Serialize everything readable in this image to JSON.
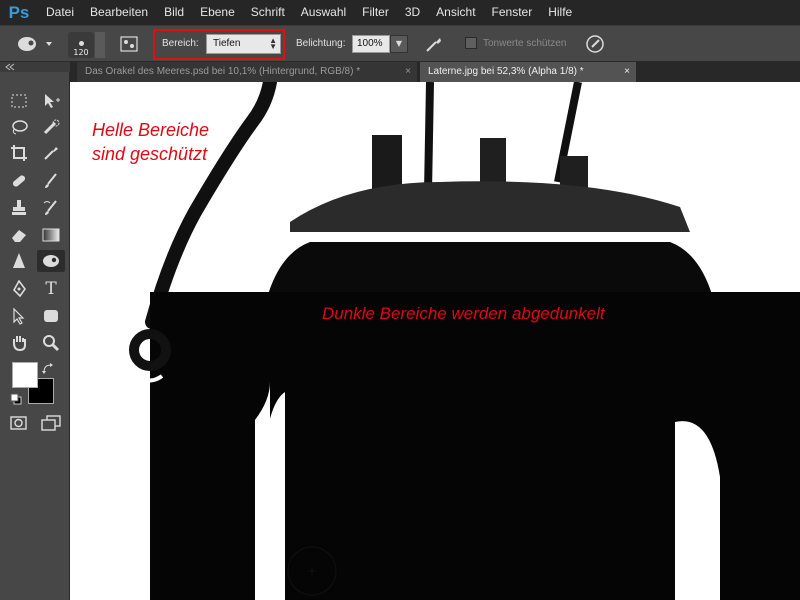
{
  "app": {
    "logo": "Ps"
  },
  "menu": [
    "Datei",
    "Bearbeiten",
    "Bild",
    "Ebene",
    "Schrift",
    "Auswahl",
    "Filter",
    "3D",
    "Ansicht",
    "Fenster",
    "Hilfe"
  ],
  "options": {
    "brush_size": "120",
    "range_label": "Bereich:",
    "range_value": "Tiefen",
    "exposure_label": "Belichtung:",
    "exposure_value": "100%",
    "protect_tones_label": "Tonwerte schützen"
  },
  "tabs": [
    {
      "label": "Das Orakel des Meeres.psd bei 10,1% (Hintergrund, RGB/8) *",
      "close": "×"
    },
    {
      "label": "Laterne.jpg bei 52,3% (Alpha 1/8) *",
      "close": "×"
    }
  ],
  "captions": {
    "bright_line1": "Helle Bereiche",
    "bright_line2": "sind geschützt",
    "dark": "Dunkle Bereiche werden abgedunkelt"
  },
  "colors": {
    "accent_red": "#e30613",
    "foreground": "#ffffff",
    "background": "#000000"
  },
  "toolbar_icons": [
    "marquee-icon",
    "move-icon",
    "lasso-icon",
    "quick-selection-icon",
    "crop-icon",
    "eyedropper-icon",
    "healing-brush-icon",
    "brush-icon",
    "clone-stamp-icon",
    "history-brush-icon",
    "eraser-icon",
    "gradient-icon",
    "blur-icon",
    "burn-sponge-icon",
    "pen-icon",
    "type-icon",
    "path-selection-icon",
    "shape-icon",
    "hand-icon",
    "zoom-icon"
  ]
}
